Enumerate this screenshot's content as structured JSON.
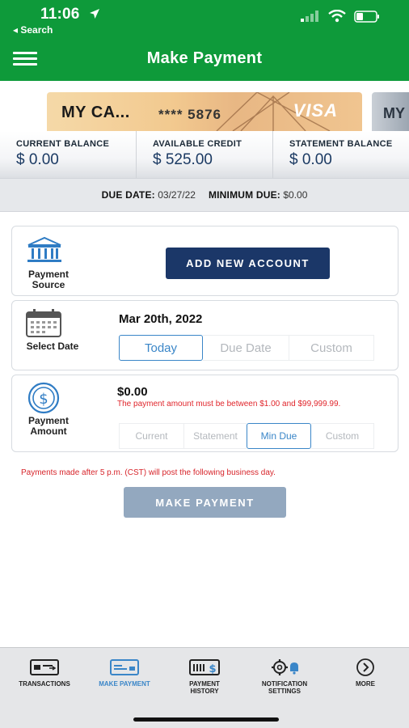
{
  "status_bar": {
    "time": "11:06",
    "back_label": "◂ Search"
  },
  "header": {
    "title": "Make Payment"
  },
  "card": {
    "name": "MY CA...",
    "masked_number": "**** 5876",
    "brand": "VISA",
    "next_card_text": "MY"
  },
  "balances": [
    {
      "label": "CURRENT BALANCE",
      "value": "$ 0.00"
    },
    {
      "label": "AVAILABLE CREDIT",
      "value": "$ 525.00"
    },
    {
      "label": "STATEMENT BALANCE",
      "value": "$ 0.00"
    }
  ],
  "due": {
    "due_date_label": "DUE DATE:",
    "due_date_value": "03/27/22",
    "min_due_label": "MINIMUM DUE:",
    "min_due_value": "$0.00"
  },
  "payment_source": {
    "label_line1": "Payment",
    "label_line2": "Source",
    "add_button": "ADD NEW ACCOUNT"
  },
  "select_date": {
    "label": "Select Date",
    "value": "Mar 20th, 2022",
    "options": [
      "Today",
      "Due Date",
      "Custom"
    ],
    "selected": "Today"
  },
  "payment_amount": {
    "label_line1": "Payment",
    "label_line2": "Amount",
    "value": "$0.00",
    "error": "The payment amount must be between $1.00 and $99,999.99.",
    "options": [
      "Current",
      "Statement",
      "Min Due",
      "Custom"
    ],
    "selected": "Min Due"
  },
  "notice": "Payments made after 5 p.m. (CST) will post the following business day.",
  "make_payment_button": "MAKE PAYMENT",
  "tabs": [
    {
      "label": "TRANSACTIONS",
      "icon": "transactions-card-icon"
    },
    {
      "label": "MAKE PAYMENT",
      "icon": "make-payment-card-icon",
      "active": true
    },
    {
      "label": "PAYMENT\nHISTORY",
      "icon": "payment-history-icon"
    },
    {
      "label": "NOTIFICATION\nSETTINGS",
      "icon": "notification-settings-icon"
    },
    {
      "label": "MORE",
      "icon": "more-chevron-icon"
    }
  ],
  "colors": {
    "header_green": "#0e9a3a",
    "navy": "#1b3768",
    "accent_blue": "#3a86c8",
    "error_red": "#e0252b",
    "disabled_button": "#93a8bf"
  }
}
